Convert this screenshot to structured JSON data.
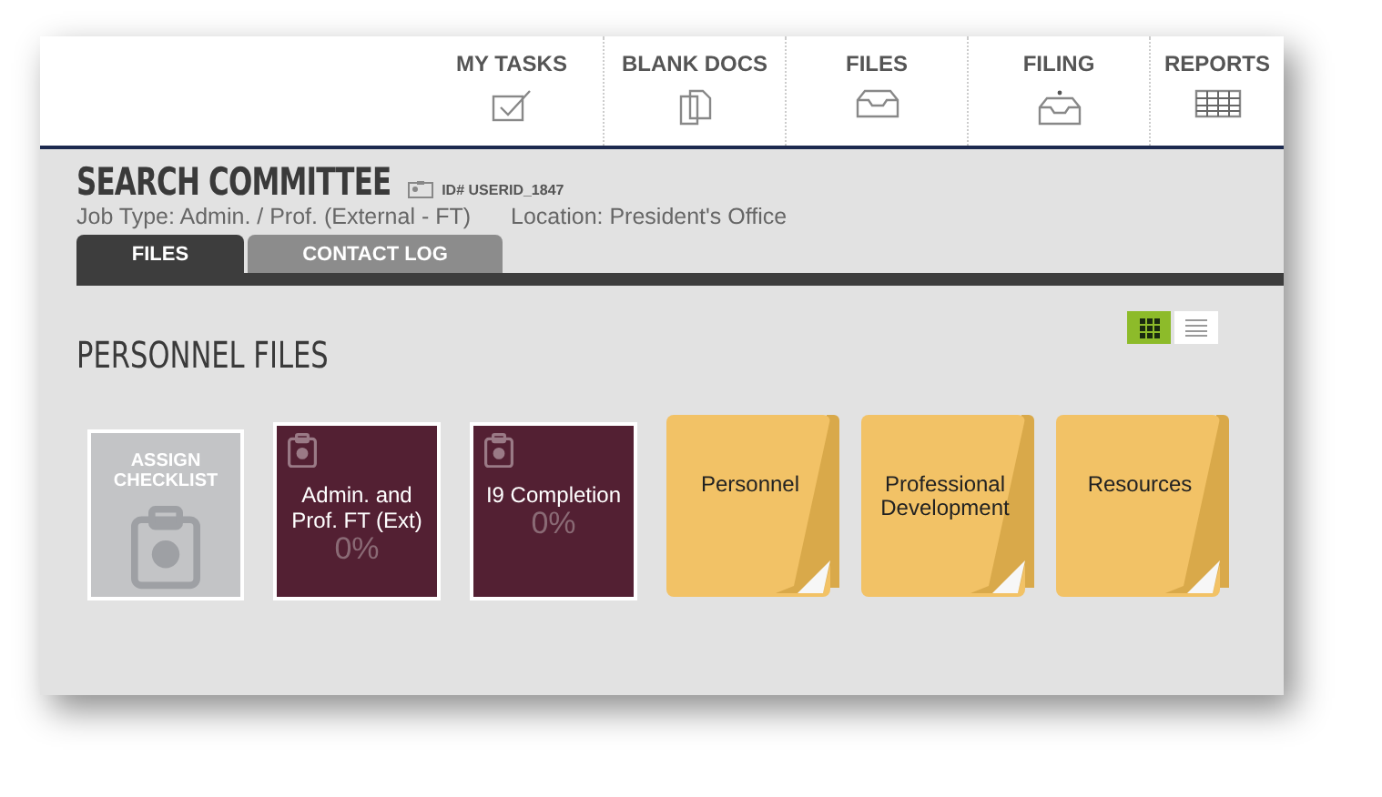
{
  "nav": [
    {
      "label": "MY TASKS"
    },
    {
      "label": "BLANK DOCS"
    },
    {
      "label": "FILES"
    },
    {
      "label": "FILING"
    },
    {
      "label": "REPORTS"
    }
  ],
  "header": {
    "title": "SEARCH COMMITTEE",
    "id": "ID# USERID_1847",
    "job_type": "Job Type: Admin. / Prof. (External - FT)",
    "location": "Location: President's Office"
  },
  "tabs": [
    {
      "label": "FILES",
      "selected": true
    },
    {
      "label": "CONTACT LOG",
      "selected": false
    }
  ],
  "section_title": "PERSONNEL FILES",
  "view_toggle": [
    {
      "kind": "grid",
      "selected": true
    },
    {
      "kind": "list",
      "selected": false
    }
  ],
  "tiles": [
    {
      "kind": "assign",
      "label": "ASSIGN CHECKLIST"
    },
    {
      "kind": "checklist",
      "label": "Admin. and Prof. FT (Ext)",
      "progress": "0%"
    },
    {
      "kind": "checklist",
      "label": "I9 Completion",
      "progress": "0%"
    },
    {
      "kind": "folder",
      "label": "Personnel"
    },
    {
      "kind": "folder",
      "label": "Professional Development"
    },
    {
      "kind": "folder",
      "label": "Resources"
    }
  ]
}
